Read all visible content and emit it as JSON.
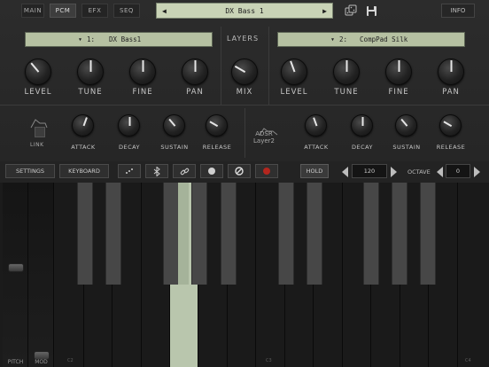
{
  "tabs": [
    {
      "label": "MAIN",
      "active": false
    },
    {
      "label": "PCM",
      "active": true
    },
    {
      "label": "EFX",
      "active": false
    },
    {
      "label": "SEQ",
      "active": false
    }
  ],
  "preset": {
    "name": "DX Bass 1",
    "prev_glyph": "◀",
    "next_glyph": "▶"
  },
  "info_label": "INFO",
  "icons": {
    "random": "dice-icon",
    "save": "floppy-disk-icon"
  },
  "layer1": {
    "number": "1:",
    "patch": "DX Bass1"
  },
  "layer2": {
    "number": "2:",
    "patch": "CompPad Silk"
  },
  "layers_label": "LAYERS",
  "knob_labels": {
    "level": "LEVEL",
    "tune": "TUNE",
    "fine": "FINE",
    "pan": "PAN",
    "mix": "MIX",
    "attack": "ATTACK",
    "decay": "DECAY",
    "sustain": "SUSTAIN",
    "release": "RELEASE"
  },
  "link_label": "LINK",
  "adsr_label": "ADSR\nLayer2",
  "toolbar": {
    "settings": "SETTINGS",
    "keyboard": "KEYBOARD",
    "hold": "HOLD",
    "tempo": "120",
    "octave_label": "OCTAVE",
    "octave": "0"
  },
  "strips": {
    "pitch": "PITCH",
    "mod": "MOD"
  },
  "key_labels": {
    "c2": "C2",
    "c3": "C3",
    "c4": "C4"
  },
  "colors": {
    "lcd": "#b6c1a2",
    "pressed_key": "#b9c6ad",
    "record": "#b3261e"
  }
}
